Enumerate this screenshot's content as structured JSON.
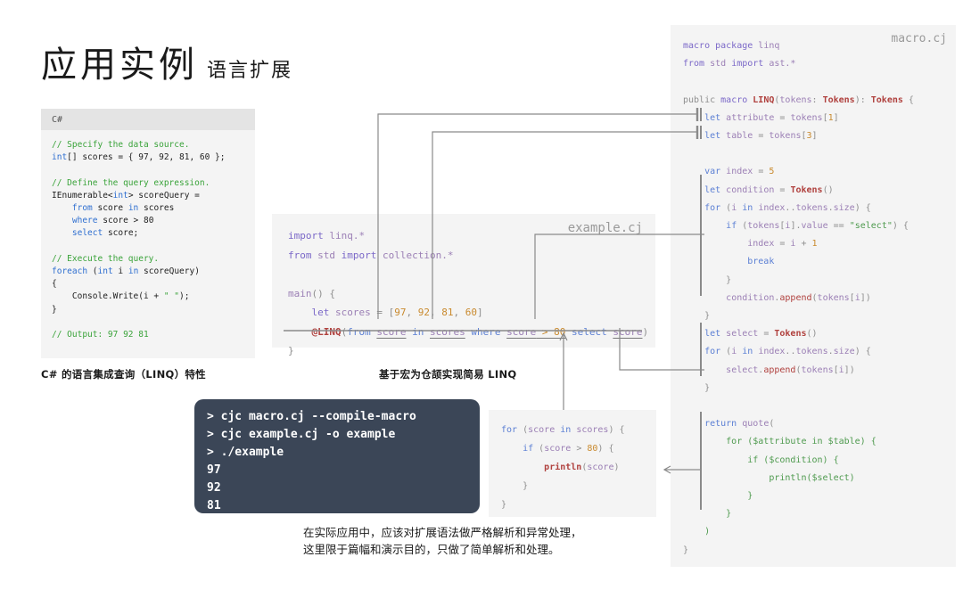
{
  "title": {
    "main": "应用实例",
    "sub": "语言扩展"
  },
  "csharp_panel": {
    "header_label": "C#",
    "code": "// Specify the data source.\nint[] scores = { 97, 92, 81, 60 };\n\n// Define the query expression.\nIEnumerable<int> scoreQuery =\n    from score in scores\n    where score > 80\n    select score;\n\n// Execute the query.\nforeach (int i in scoreQuery)\n{\n    Console.Write(i + \" \");\n}\n\n// Output: 97 92 81"
  },
  "example_panel": {
    "tag": "example.cj",
    "code": "import linq.*\nfrom std import collection.*\n\nmain() {\n    let scores = [97, 92, 81, 60]\n    @LINQ(from score in scores where score > 80 select score)\n}"
  },
  "macro_panel": {
    "tag": "macro.cj",
    "code": "macro package linq\nfrom std import ast.*\n\npublic macro LINQ(tokens: Tokens): Tokens {\n    let attribute = tokens[1]\n    let table = tokens[3]\n\n    var index = 5\n    let condition = Tokens()\n    for (i in index..tokens.size) {\n        if (tokens[i].value == \"select\") {\n            index = i + 1\n            break\n        }\n        condition.append(tokens[i])\n    }\n    let select = Tokens()\n    for (i in index..tokens.size) {\n        select.append(tokens[i])\n    }\n\n    return quote(\n        for ($attribute in $table) {\n            if ($condition) {\n                println($select)\n            }\n        }\n    )\n}"
  },
  "expansion_panel": {
    "code": "for (score in scores) {\n    if (score > 80) {\n        println(score)\n    }\n}"
  },
  "terminal": {
    "lines": [
      "> cjc macro.cj --compile-macro",
      "> cjc example.cj -o example",
      "> ./example",
      "97",
      "92",
      "81"
    ],
    "text": "> cjc macro.cj --compile-macro\n> cjc example.cj -o example\n> ./example\n97\n92\n81",
    "background_color": "#3b4657"
  },
  "captions": {
    "csharp": "C# 的语言集成查询（LINQ）特性",
    "example": "基于宏为仓颉实现简易 LINQ",
    "note": "在实际应用中，应该对扩展语法做严格解析和异常处理，\n这里限于篇幅和演示目的，只做了简单解析和处理。"
  },
  "colors": {
    "panel_bg": "#f4f4f4",
    "panel_header_bg": "#e4e4e4",
    "terminal_bg": "#3b4657",
    "wire": "#8a8a8a",
    "keyword_purple": "#7b68c8",
    "keyword_blue": "#5b7fd4",
    "number_orange": "#c98a2e",
    "string_green": "#4e9a4e",
    "type_red": "#b0413e",
    "comment_green": "#3aa33a"
  }
}
